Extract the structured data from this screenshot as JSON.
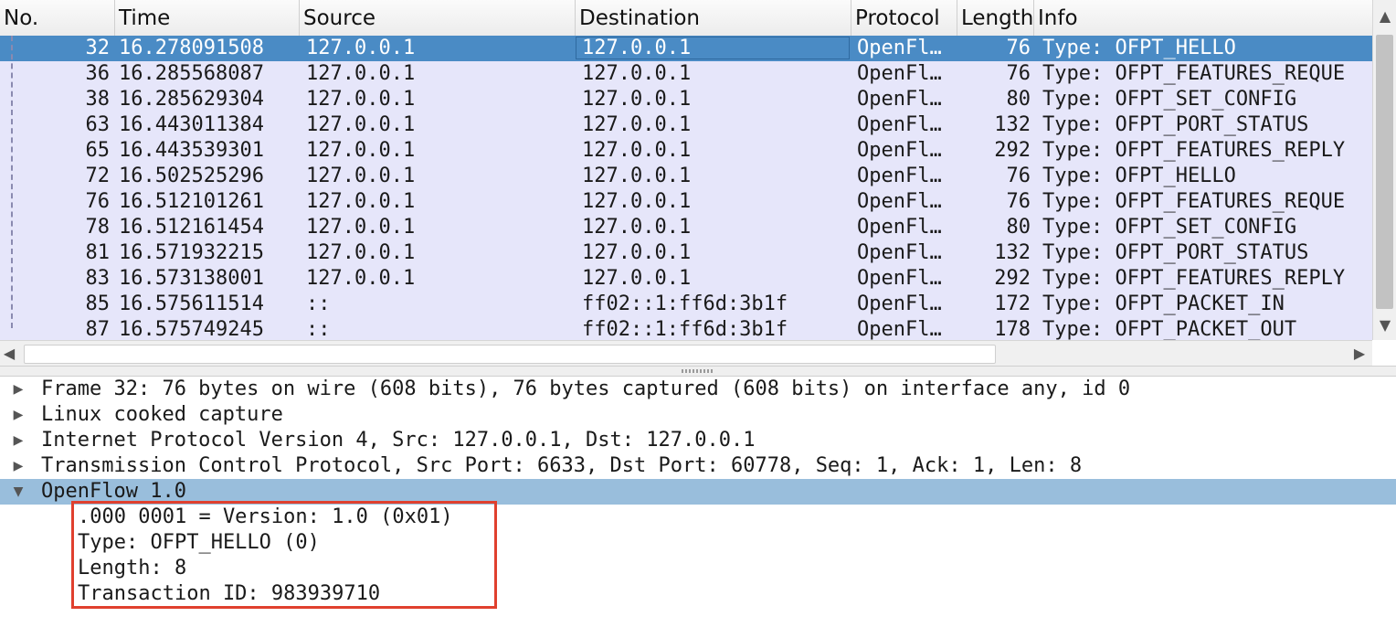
{
  "columns": {
    "no": "No.",
    "time": "Time",
    "source": "Source",
    "destination": "Destination",
    "protocol": "Protocol",
    "length": "Length",
    "info": "Info"
  },
  "packets": [
    {
      "no": "32",
      "time": "16.278091508",
      "src": "127.0.0.1",
      "dst": "127.0.0.1",
      "proto": "OpenFl…",
      "len": "76",
      "info": "Type: OFPT_HELLO"
    },
    {
      "no": "36",
      "time": "16.285568087",
      "src": "127.0.0.1",
      "dst": "127.0.0.1",
      "proto": "OpenFl…",
      "len": "76",
      "info": "Type: OFPT_FEATURES_REQUE"
    },
    {
      "no": "38",
      "time": "16.285629304",
      "src": "127.0.0.1",
      "dst": "127.0.0.1",
      "proto": "OpenFl…",
      "len": "80",
      "info": "Type: OFPT_SET_CONFIG"
    },
    {
      "no": "63",
      "time": "16.443011384",
      "src": "127.0.0.1",
      "dst": "127.0.0.1",
      "proto": "OpenFl…",
      "len": "132",
      "info": "Type: OFPT_PORT_STATUS"
    },
    {
      "no": "65",
      "time": "16.443539301",
      "src": "127.0.0.1",
      "dst": "127.0.0.1",
      "proto": "OpenFl…",
      "len": "292",
      "info": "Type: OFPT_FEATURES_REPLY"
    },
    {
      "no": "72",
      "time": "16.502525296",
      "src": "127.0.0.1",
      "dst": "127.0.0.1",
      "proto": "OpenFl…",
      "len": "76",
      "info": "Type: OFPT_HELLO"
    },
    {
      "no": "76",
      "time": "16.512101261",
      "src": "127.0.0.1",
      "dst": "127.0.0.1",
      "proto": "OpenFl…",
      "len": "76",
      "info": "Type: OFPT_FEATURES_REQUE"
    },
    {
      "no": "78",
      "time": "16.512161454",
      "src": "127.0.0.1",
      "dst": "127.0.0.1",
      "proto": "OpenFl…",
      "len": "80",
      "info": "Type: OFPT_SET_CONFIG"
    },
    {
      "no": "81",
      "time": "16.571932215",
      "src": "127.0.0.1",
      "dst": "127.0.0.1",
      "proto": "OpenFl…",
      "len": "132",
      "info": "Type: OFPT_PORT_STATUS"
    },
    {
      "no": "83",
      "time": "16.573138001",
      "src": "127.0.0.1",
      "dst": "127.0.0.1",
      "proto": "OpenFl…",
      "len": "292",
      "info": "Type: OFPT_FEATURES_REPLY"
    },
    {
      "no": "85",
      "time": "16.575611514",
      "src": "::",
      "dst": "ff02::1:ff6d:3b1f",
      "proto": "OpenFl…",
      "len": "172",
      "info": "Type: OFPT_PACKET_IN"
    },
    {
      "no": "87",
      "time": "16.575749245",
      "src": "::",
      "dst": "ff02::1:ff6d:3b1f",
      "proto": "OpenFl…",
      "len": "178",
      "info": "Type: OFPT_PACKET_OUT"
    }
  ],
  "details": {
    "frame": "Frame 32: 76 bytes on wire (608 bits), 76 bytes captured (608 bits) on interface any, id 0",
    "linux": "Linux cooked capture",
    "ip": "Internet Protocol Version 4, Src: 127.0.0.1, Dst: 127.0.0.1",
    "tcp": "Transmission Control Protocol, Src Port: 6633, Dst Port: 60778, Seq: 1, Ack: 1, Len: 8",
    "openflow": "OpenFlow 1.0",
    "openflow_fields": {
      "version": ".000 0001 = Version: 1.0 (0x01)",
      "type": "Type: OFPT_HELLO (0)",
      "length": "Length: 8",
      "xid": "Transaction ID: 983939710"
    }
  },
  "colors": {
    "row_bg": "#e6e6fa",
    "selected_row": "#4a8bc5",
    "selected_detail": "#99bedc",
    "highlight_box": "#e0402e"
  },
  "icons": {
    "collapsed": "triangle-right-icon",
    "expanded": "triangle-down-icon"
  }
}
